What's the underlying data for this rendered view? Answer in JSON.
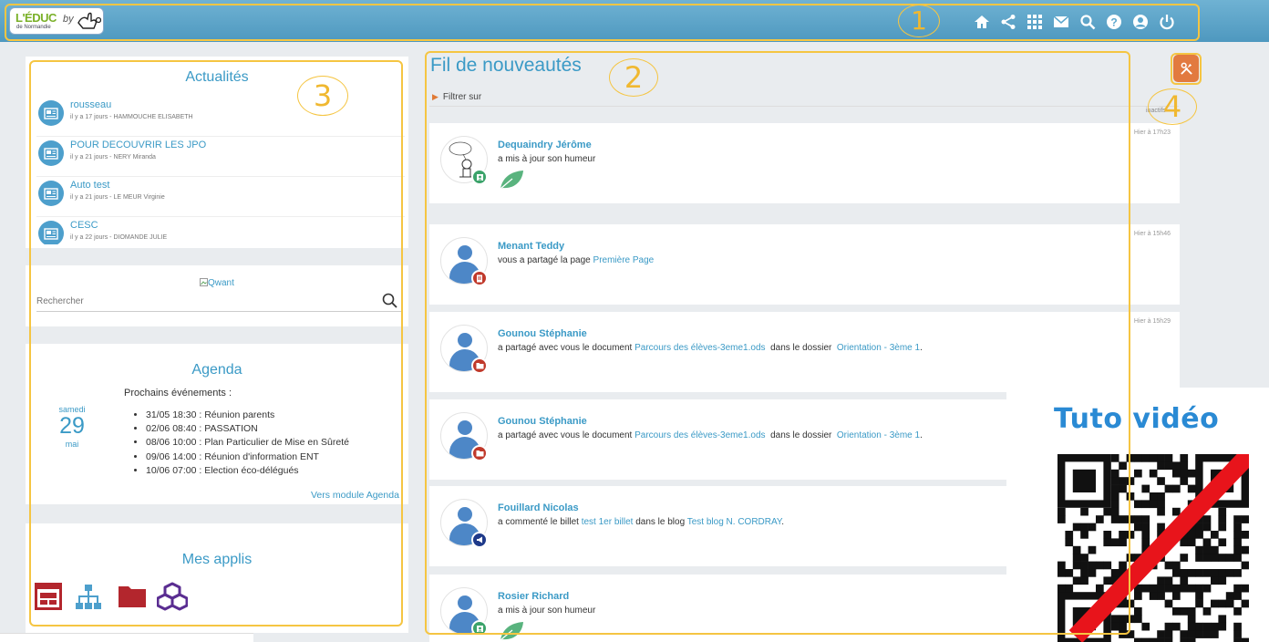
{
  "header": {
    "logo_text": "L'ÉDUC",
    "logo_sub": "de Normandie",
    "logo_by": "by",
    "nav_icons": [
      "home-icon",
      "share-icon",
      "apps-grid-icon",
      "mail-icon",
      "search-icon",
      "help-icon",
      "user-icon",
      "power-icon"
    ],
    "brand_color": "#5aa6cd"
  },
  "callouts": {
    "one": "1",
    "two": "2",
    "three": "3",
    "four": "4"
  },
  "actualites": {
    "title": "Actualités",
    "items": [
      {
        "title": "rousseau",
        "meta": "il y a 17 jours - HAMMOUCHE ELISABETH"
      },
      {
        "title": "POUR DECOUVRIR LES JPO",
        "meta": "il y a 21 jours - NERY Miranda"
      },
      {
        "title": "Auto test",
        "meta": "il y a 21 jours - LE MEUR Virginie"
      },
      {
        "title": "CESC",
        "meta": "il y a 22 jours - DIOMANDE JULIE"
      }
    ]
  },
  "search": {
    "image_alt": "Qwant",
    "placeholder": "Rechercher"
  },
  "agenda": {
    "title": "Agenda",
    "subtitle": "Prochains événements :",
    "day_name": "samedi",
    "day_num": "29",
    "month": "mai",
    "events": [
      "31/05 18:30 : Réunion parents",
      "02/06 08:40 : PASSATION",
      "08/06 10:00 : Plan Particulier de Mise en Sûreté",
      "09/06 14:00 : Réunion d'information ENT",
      "10/06 07:00 : Election éco-délégués"
    ],
    "link": "Vers module Agenda"
  },
  "apps": {
    "title": "Mes applis",
    "icons": [
      "calendar-app-icon",
      "sitemap-app-icon",
      "folder-app-icon",
      "cubes-app-icon"
    ]
  },
  "feed": {
    "title": "Fil de nouveautés",
    "filter": "Filtrer sur",
    "inactive_label": "inactifs",
    "cards": [
      {
        "name": "Dequaindry Jérôme",
        "parts": [
          {
            "t": "a mis à jour son humeur",
            "link": false
          }
        ],
        "time": "Hier à 17h23",
        "badge_color": "#3ba36a",
        "badge_icon": "contact-icon",
        "mood": true,
        "drawing": true
      },
      {
        "name": "Menant Teddy",
        "parts": [
          {
            "t": "vous a partagé la page ",
            "link": false
          },
          {
            "t": "Première Page",
            "link": true
          }
        ],
        "time": "Hier à 15h46",
        "badge_color": "#c0392b",
        "badge_icon": "page-icon",
        "mood": false
      },
      {
        "name": "Gounou Stéphanie",
        "parts": [
          {
            "t": "a partagé avec vous le document ",
            "link": false
          },
          {
            "t": "Parcours des élèves-3eme1.ods",
            "link": true
          },
          {
            "t": "  dans le dossier  ",
            "link": false
          },
          {
            "t": "Orientation - 3ème 1",
            "link": true
          },
          {
            "t": ".",
            "link": false
          }
        ],
        "time": "Hier à 15h29",
        "badge_color": "#c0392b",
        "badge_icon": "folder-icon",
        "mood": false
      },
      {
        "name": "Gounou Stéphanie",
        "parts": [
          {
            "t": "a partagé avec vous le document ",
            "link": false
          },
          {
            "t": "Parcours des élèves-3eme1.ods",
            "link": true
          },
          {
            "t": "  dans le dossier  ",
            "link": false
          },
          {
            "t": "Orientation - 3ème 1",
            "link": true
          },
          {
            "t": ".",
            "link": false
          }
        ],
        "time": "",
        "badge_color": "#c0392b",
        "badge_icon": "folder-icon",
        "mood": false
      },
      {
        "name": "Fouillard Nicolas",
        "parts": [
          {
            "t": "a commenté le billet ",
            "link": false
          },
          {
            "t": "test 1er billet",
            "link": true
          },
          {
            "t": " dans le blog ",
            "link": false
          },
          {
            "t": "Test blog N. CORDRAY",
            "link": true
          },
          {
            "t": ".",
            "link": false
          }
        ],
        "time": "",
        "badge_color": "#1f3a8a",
        "badge_icon": "megaphone-icon",
        "mood": false
      },
      {
        "name": "Rosier Richard",
        "parts": [
          {
            "t": "a mis à jour son humeur",
            "link": false
          }
        ],
        "time": "",
        "badge_color": "#3ba36a",
        "badge_icon": "contact-icon",
        "mood": true
      }
    ]
  },
  "tools": {
    "icon": "tools-icon"
  },
  "tuto": {
    "label": "Tuto vidéo"
  },
  "colors": {
    "accent": "#3b9ac6",
    "orange": "#e27a3f",
    "callout": "#f5c542",
    "strike": "#e8141b"
  }
}
